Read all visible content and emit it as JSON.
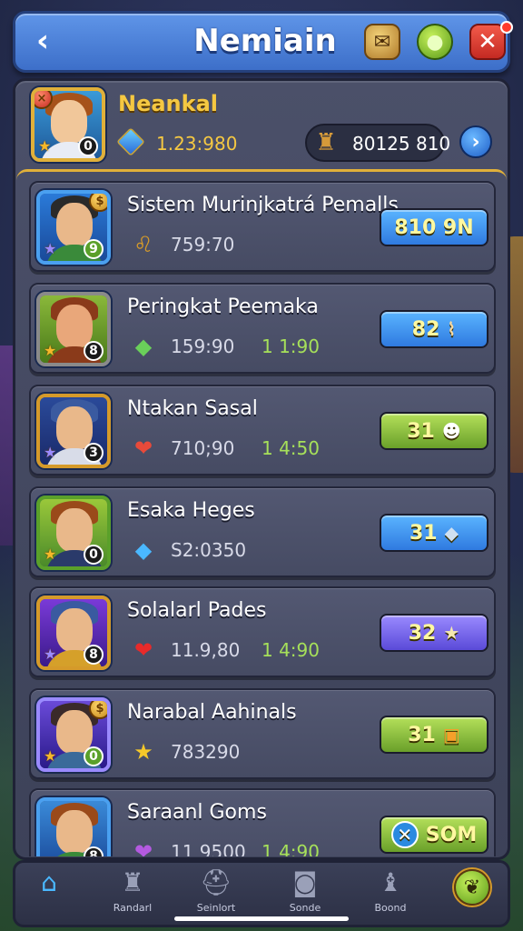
{
  "header": {
    "title": "Nemiain",
    "back_icon": "chevron-left-icon",
    "shop_icon": "scroll-icon",
    "chat_icon": "chat-bubble-icon",
    "close_icon": "close-icon"
  },
  "player": {
    "name": "Neankal",
    "level": "0",
    "currency": "1.23:980",
    "score": "80125 810"
  },
  "list": [
    {
      "title": "Sistem Murinjkatrá Pemalls",
      "stat1": "759:70",
      "stat2": "",
      "reward": "810 9N",
      "reward_color": "blue",
      "level": "9",
      "icon": "lion-icon"
    },
    {
      "title": "Peringkat Peemaka",
      "stat1": "159:90",
      "stat2": "1 1:90",
      "reward": "82",
      "reward_color": "blue",
      "level": "8",
      "icon": "green-gem-icon"
    },
    {
      "title": "Ntakan Sasal",
      "stat1": "710;90",
      "stat2": "1 4:50",
      "reward": "31",
      "reward_color": "green",
      "level": "3",
      "icon": "heart-icon"
    },
    {
      "title": "Esaka Heges",
      "stat1": "S2:0350",
      "stat2": "",
      "reward": "31",
      "reward_color": "blue",
      "level": "0",
      "icon": "blue-gem-icon"
    },
    {
      "title": "Solalarl Pades",
      "stat1": "11.9,80",
      "stat2": "1 4:90",
      "reward": "32",
      "reward_color": "purple",
      "level": "8",
      "icon": "red-heart-icon"
    },
    {
      "title": "Narabal Aahinals",
      "stat1": "783290",
      "stat2": "",
      "reward": "31",
      "reward_color": "green",
      "level": "0",
      "icon": "star-icon"
    },
    {
      "title": "Saraanl Goms",
      "stat1": "11 9500",
      "stat2": "1 4:90",
      "reward": "SOM",
      "reward_color": "green",
      "level": "8",
      "icon": "purple-heart-icon"
    }
  ],
  "nav": {
    "items": [
      {
        "label": "",
        "icon": "home-icon"
      },
      {
        "label": "Randarl",
        "icon": "castle-icon"
      },
      {
        "label": "Seinlort",
        "icon": "helmet-icon"
      },
      {
        "label": "Sonde",
        "icon": "camera-icon"
      },
      {
        "label": "Boond",
        "icon": "bag-icon"
      }
    ]
  }
}
